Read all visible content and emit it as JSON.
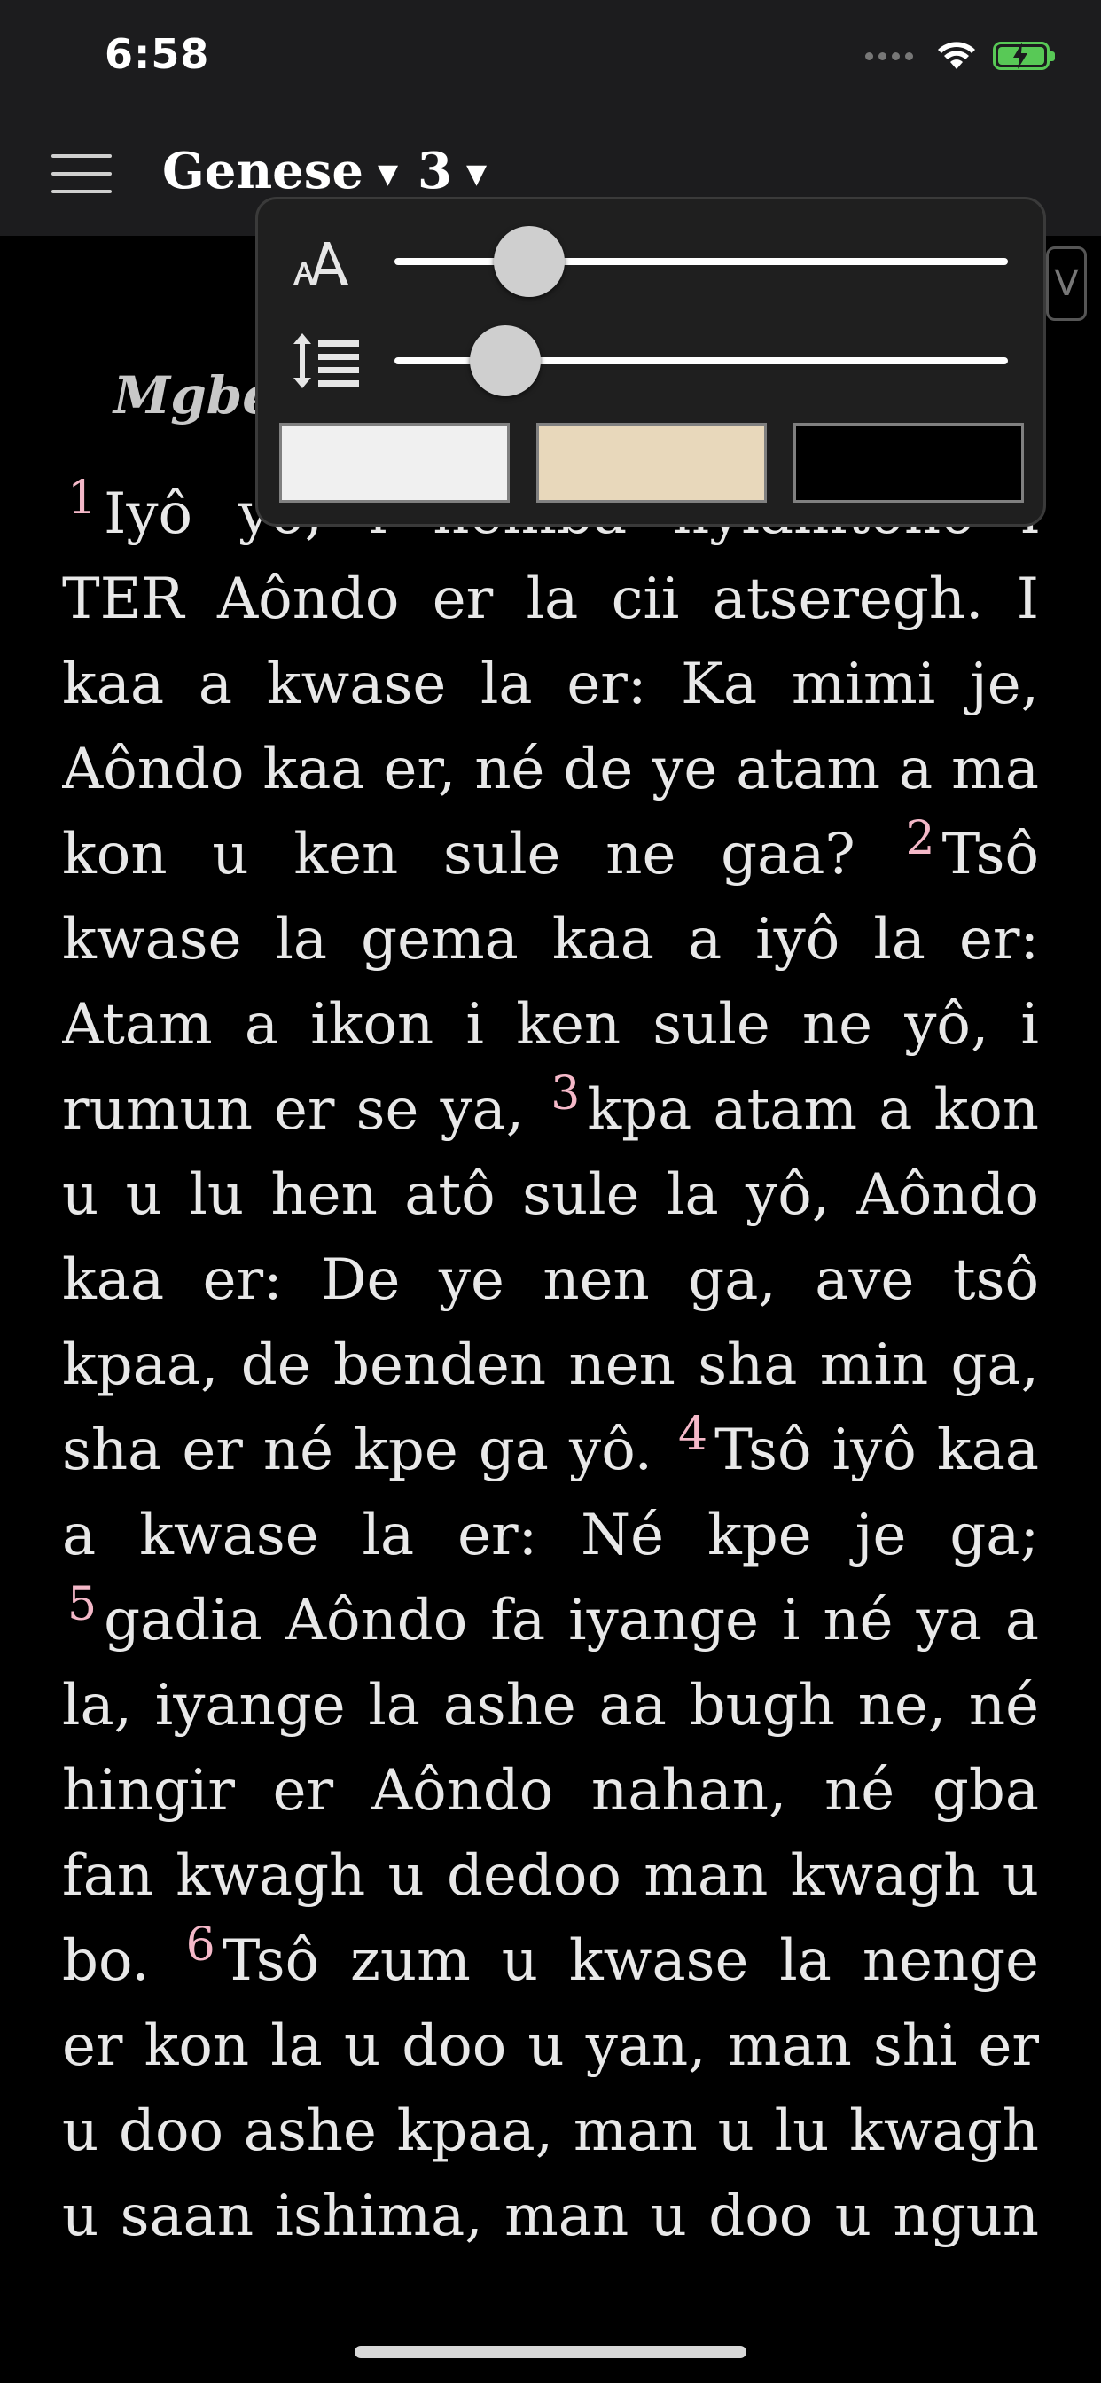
{
  "status_bar": {
    "time": "6:58",
    "battery_color": "#58c956",
    "icons": [
      "signal-dots-icon",
      "wifi-icon",
      "battery-charging-icon"
    ]
  },
  "header": {
    "book": "Genese",
    "chapter": "3",
    "menu_icon": "hamburger-icon",
    "dropdown_icon": "caret-down-icon"
  },
  "reader": {
    "section_heading": "Mgbe",
    "partial_button_label": "V",
    "verse_number_color": "#f4b8c8",
    "verses": [
      {
        "num": "1",
        "text": "Iyô yô, i hemba nyiamtoho i TER Aôndo er la cii atseregh. I kaa a kwase la er: Ka mimi je, Aôndo kaa er, né de ye atam a ma kon u ken sule ne gaa?"
      },
      {
        "num": "2",
        "text": "Tsô kwase la gema kaa a iyô la er: Atam a ikon i ken sule ne yô, i rumun er se ya,"
      },
      {
        "num": "3",
        "text": "kpa atam a kon u u lu hen atô sule la yô, Aôndo kaa er: De ye nen ga, ave tsô kpaa, de benden nen sha min ga, sha er né kpe ga yô."
      },
      {
        "num": "4",
        "text": "Tsô iyô kaa a kwase la er: Né kpe je ga;"
      },
      {
        "num": "5",
        "text": "gadia Aôndo fa iyange i né ya a la, iyange la ashe aa bugh ne, né hingir er Aôndo nahan, né gba fan kwagh u dedoo man kwagh u bo."
      },
      {
        "num": "6",
        "text": "Tsô zum u kwase la nenge er kon la u doo u yan, man shi er u doo ashe kpaa, man u lu kwagh u saan ishima, man u doo u ngun u"
      }
    ]
  },
  "display_settings": {
    "font_size_icon": "font-size-icon",
    "line_spacing_icon": "line-spacing-icon",
    "font_size_level": 0.22,
    "line_spacing_level": 0.18,
    "themes": [
      {
        "name": "light",
        "color": "#f0f0f0"
      },
      {
        "name": "sepia",
        "color": "#e8d8bb"
      },
      {
        "name": "dark",
        "color": "#000000"
      }
    ]
  }
}
